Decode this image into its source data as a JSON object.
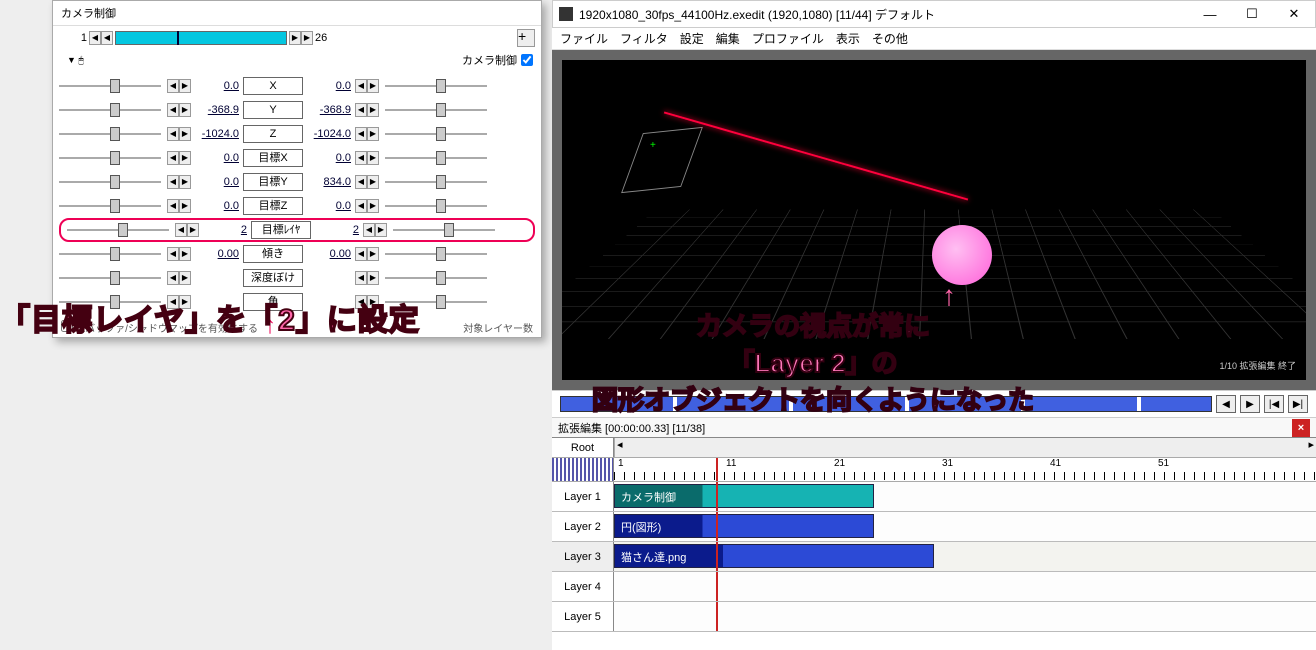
{
  "left_panel": {
    "title": "カメラ制御",
    "frame_current": "1",
    "frame_total": "26",
    "cam_label": "カメラ制御",
    "params": [
      {
        "left": "0.0",
        "label": "X",
        "right": "0.0"
      },
      {
        "left": "-368.9",
        "label": "Y",
        "right": "-368.9"
      },
      {
        "left": "-1024.0",
        "label": "Z",
        "right": "-1024.0"
      },
      {
        "left": "0.0",
        "label": "目標X",
        "right": "0.0"
      },
      {
        "left": "0.0",
        "label": "目標Y",
        "right": "834.0"
      },
      {
        "left": "0.0",
        "label": "目標Z",
        "right": "0.0"
      },
      {
        "left": "2",
        "label": "目標ﾚｲﾔ",
        "right": "2",
        "highlight": true
      },
      {
        "left": "0.00",
        "label": "傾き",
        "right": "0.00"
      },
      {
        "left": "",
        "label": "深度ぼけ",
        "right": ""
      },
      {
        "left": "",
        "label": "角",
        "right": ""
      }
    ],
    "bottom_checkbox": "Zバッファ/シャドウマップを有効にする",
    "bottom_right": "対象レイヤー数"
  },
  "anno_left": "「目標レイヤ」を「2」に設定",
  "anno_right": "カメラの視点が常に\n「Layer 2」の\n図形オブジェクトを向くようになった",
  "main_window": {
    "title": "1920x1080_30fps_44100Hz.exedit (1920,1080)  [11/44]  デフォルト",
    "menus": [
      "ファイル",
      "フィルタ",
      "設定",
      "編集",
      "プロファイル",
      "表示",
      "その他"
    ],
    "info_box": "1/10\n拡張編集\n終了"
  },
  "timeline": {
    "header": "拡張編集 [00:00:00.33] [11/38]",
    "root_label": "Root",
    "ticks": [
      "1",
      "11",
      "21",
      "31",
      "41",
      "51"
    ],
    "layers": [
      {
        "name": "Layer 1",
        "clip": "カメラ制御",
        "cls": "cam"
      },
      {
        "name": "Layer 2",
        "clip": "円(図形)",
        "cls": "shape"
      },
      {
        "name": "Layer 3",
        "clip": "猫さん達.png",
        "cls": "img",
        "sel": true
      },
      {
        "name": "Layer 4"
      },
      {
        "name": "Layer 5"
      }
    ]
  }
}
